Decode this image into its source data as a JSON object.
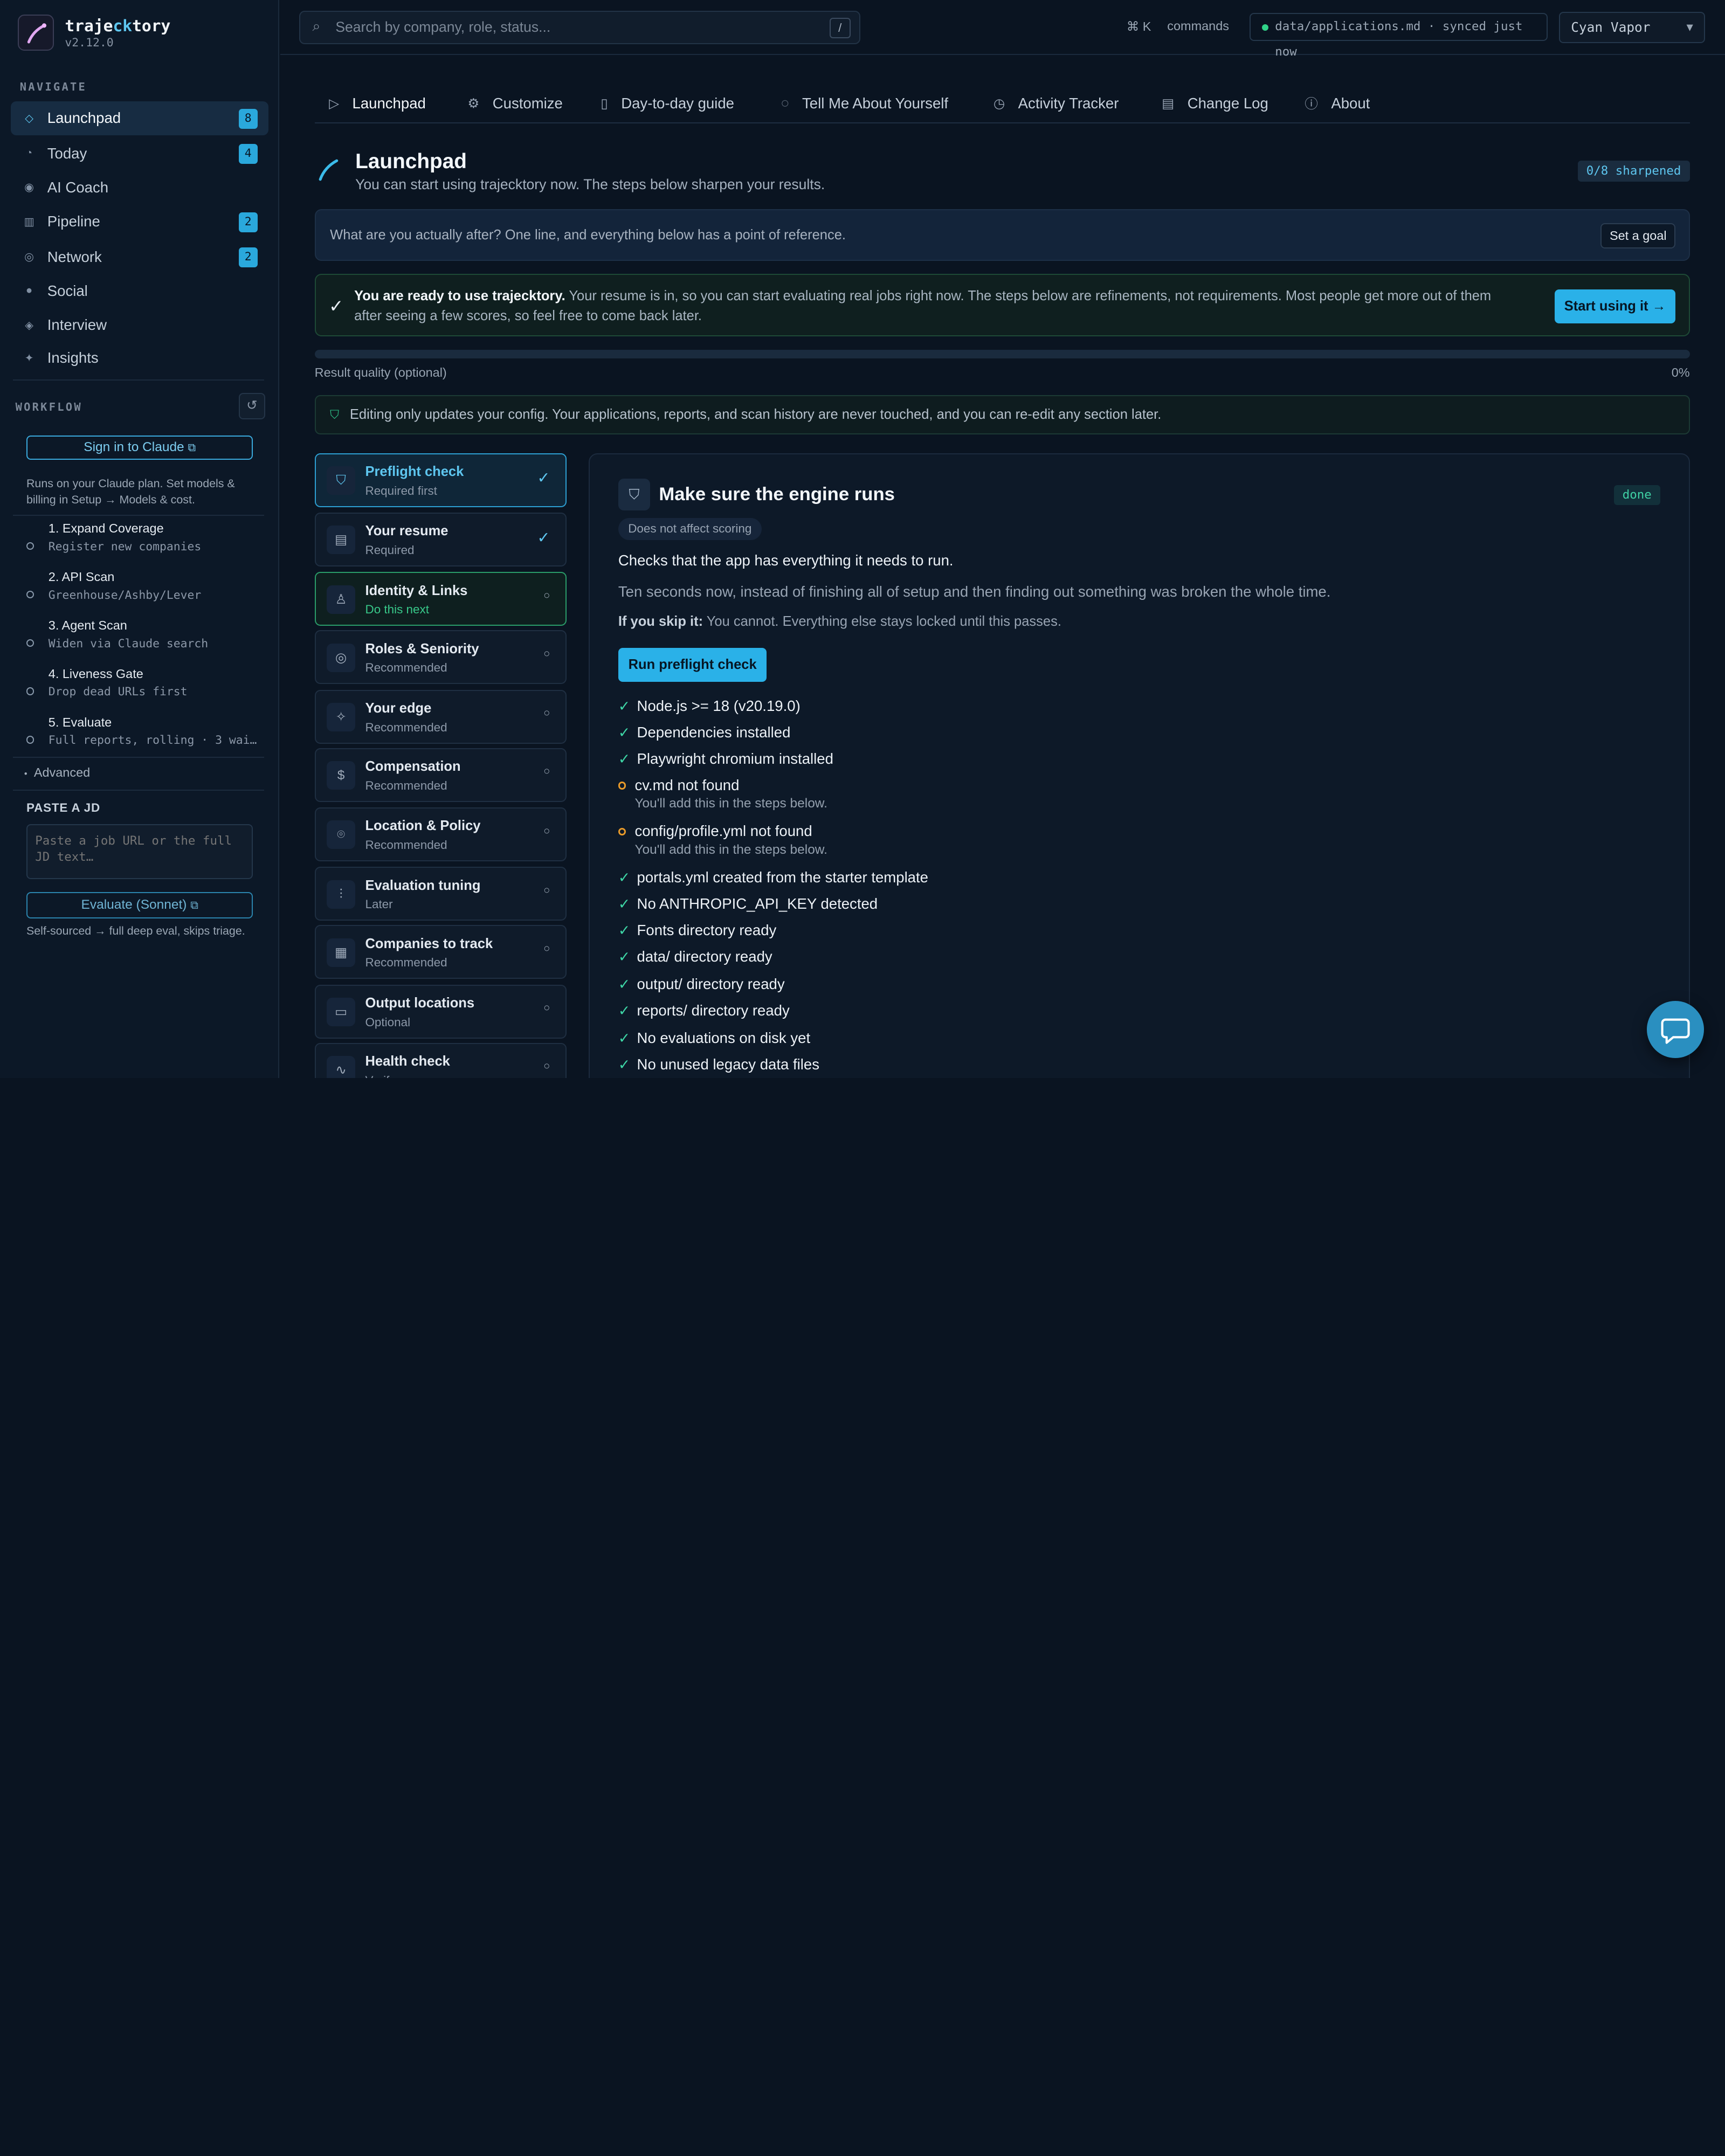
{
  "app": {
    "name_prefix": "traje",
    "name_highlight": "ck",
    "name_suffix": "tory",
    "version": "v2.12.0"
  },
  "sidebar": {
    "nav_label": "NAVIGATE",
    "items": [
      {
        "label": "Launchpad",
        "icon": "diamond-icon",
        "badge": "8"
      },
      {
        "label": "Today",
        "icon": "clock-icon",
        "badge": "4"
      },
      {
        "label": "AI Coach",
        "icon": "coach-icon",
        "badge": ""
      },
      {
        "label": "Pipeline",
        "icon": "pipeline-icon",
        "badge": "2"
      },
      {
        "label": "Network",
        "icon": "network-icon",
        "badge": "2"
      },
      {
        "label": "Social",
        "icon": "social-icon",
        "badge": ""
      },
      {
        "label": "Interview",
        "icon": "interview-icon",
        "badge": ""
      },
      {
        "label": "Insights",
        "icon": "sparkle-icon",
        "badge": ""
      }
    ],
    "workflow_label": "WORKFLOW",
    "signin_label": "Sign in to Claude",
    "plan_note": "Runs on your Claude plan. Set models & billing in Setup → Models & cost.",
    "workflow_steps": [
      {
        "title": "1. Expand Coverage",
        "sub": "Register new companies"
      },
      {
        "title": "2. API Scan",
        "sub": "Greenhouse/Ashby/Lever"
      },
      {
        "title": "3. Agent Scan",
        "sub": "Widen via Claude search"
      },
      {
        "title": "4. Liveness Gate",
        "sub": "Drop dead URLs first"
      },
      {
        "title": "5. Evaluate",
        "sub": "Full reports, rolling · 3 wai…"
      }
    ],
    "advanced_label": "Advanced",
    "paste_label": "PASTE A JD",
    "paste_placeholder": "Paste a job URL or the full JD text…",
    "evaluate_label": "Evaluate (Sonnet)",
    "self_note": "Self-sourced → full deep eval, skips triage."
  },
  "topbar": {
    "search_placeholder": "Search by company, role, status...",
    "search_key": "/",
    "cmd_key": "⌘ K",
    "commands_label": "commands",
    "sync_text": "data/applications.md · synced just now",
    "theme": "Cyan Vapor"
  },
  "tabs": [
    {
      "label": "Launchpad",
      "icon": "play-icon"
    },
    {
      "label": "Customize",
      "icon": "gear-icon"
    },
    {
      "label": "Day-to-day guide",
      "icon": "book-icon"
    },
    {
      "label": "Tell Me About Yourself",
      "icon": "chat-icon"
    },
    {
      "label": "Activity Tracker",
      "icon": "clock-icon"
    },
    {
      "label": "Change Log",
      "icon": "file-icon"
    },
    {
      "label": "About",
      "icon": "info-icon"
    }
  ],
  "header": {
    "title": "Launchpad",
    "subtitle": "You can start using trajecktory now. The steps below sharpen your results.",
    "sharpened": "0/8 sharpened"
  },
  "goal": {
    "text": "What are you actually after? One line, and everything below has a point of reference.",
    "button": "Set a goal"
  },
  "ready": {
    "bold": "You are ready to use trajecktory.",
    "text": " Your resume is in, so you can start evaluating real jobs right now. The steps below are refinements, not requirements. Most people get more out of them after seeing a few scores, so feel free to come back later.",
    "button": "Start using it →"
  },
  "quality": {
    "label": "Result quality (optional)",
    "value_text": "0%",
    "value": 0
  },
  "note": "Editing only updates your config. Your applications, reports, and scan history are never touched, and you can re-edit any section later.",
  "steps": [
    {
      "title": "Preflight check",
      "sub": "Required first",
      "icon": "shield-icon",
      "status": "✓"
    },
    {
      "title": "Your resume",
      "sub": "Required",
      "icon": "document-icon",
      "status": "✓"
    },
    {
      "title": "Identity & Links",
      "sub": "Do this next",
      "icon": "user-icon",
      "status": "○"
    },
    {
      "title": "Roles & Seniority",
      "sub": "Recommended",
      "icon": "target-icon",
      "status": "○"
    },
    {
      "title": "Your edge",
      "sub": "Recommended",
      "icon": "sparkle-icon",
      "status": "○"
    },
    {
      "title": "Compensation",
      "sub": "Recommended",
      "icon": "dollar-icon",
      "status": "○"
    },
    {
      "title": "Location & Policy",
      "sub": "Recommended",
      "icon": "pin-icon",
      "status": "○"
    },
    {
      "title": "Evaluation tuning",
      "sub": "Later",
      "icon": "sliders-icon",
      "status": "○"
    },
    {
      "title": "Companies to track",
      "sub": "Recommended",
      "icon": "building-icon",
      "status": "○"
    },
    {
      "title": "Output locations",
      "sub": "Optional",
      "icon": "folder-icon",
      "status": "○"
    },
    {
      "title": "Health check",
      "sub": "Verify",
      "icon": "pulse-icon",
      "status": "○"
    }
  ],
  "panel": {
    "title": "Make sure the engine runs",
    "status": "done",
    "pill": "Does not affect scoring",
    "desc": "Checks that the app has everything it needs to run.",
    "desc2": "Ten seconds now, instead of finishing all of setup and then finding out something was broken the whole time.",
    "skip_label": "If you skip it:",
    "skip_text": " You cannot. Everything else stays locked until this passes.",
    "run_button": "Run preflight check",
    "checks": [
      {
        "ok": true,
        "text": "Node.js >= 18 (v20.19.0)",
        "note": ""
      },
      {
        "ok": true,
        "text": "Dependencies installed",
        "note": ""
      },
      {
        "ok": true,
        "text": "Playwright chromium installed",
        "note": ""
      },
      {
        "ok": false,
        "text": "cv.md not found",
        "note": "You'll add this in the steps below."
      },
      {
        "ok": false,
        "text": "config/profile.yml not found",
        "note": "You'll add this in the steps below."
      },
      {
        "ok": true,
        "text": "portals.yml created from the starter template",
        "note": ""
      },
      {
        "ok": true,
        "text": "No ANTHROPIC_API_KEY detected",
        "note": ""
      },
      {
        "ok": true,
        "text": "Fonts directory ready",
        "note": ""
      },
      {
        "ok": true,
        "text": "data/ directory ready",
        "note": ""
      },
      {
        "ok": true,
        "text": "output/ directory ready",
        "note": ""
      },
      {
        "ok": true,
        "text": "reports/ directory ready",
        "note": ""
      },
      {
        "ok": true,
        "text": "No evaluations on disk yet",
        "note": ""
      },
      {
        "ok": true,
        "text": "No unused legacy data files",
        "note": ""
      }
    ]
  },
  "colors": {
    "accent": "#2ab1e8",
    "success": "#3ed6a6",
    "warning": "#e89a2a",
    "background": "#0a1421"
  }
}
